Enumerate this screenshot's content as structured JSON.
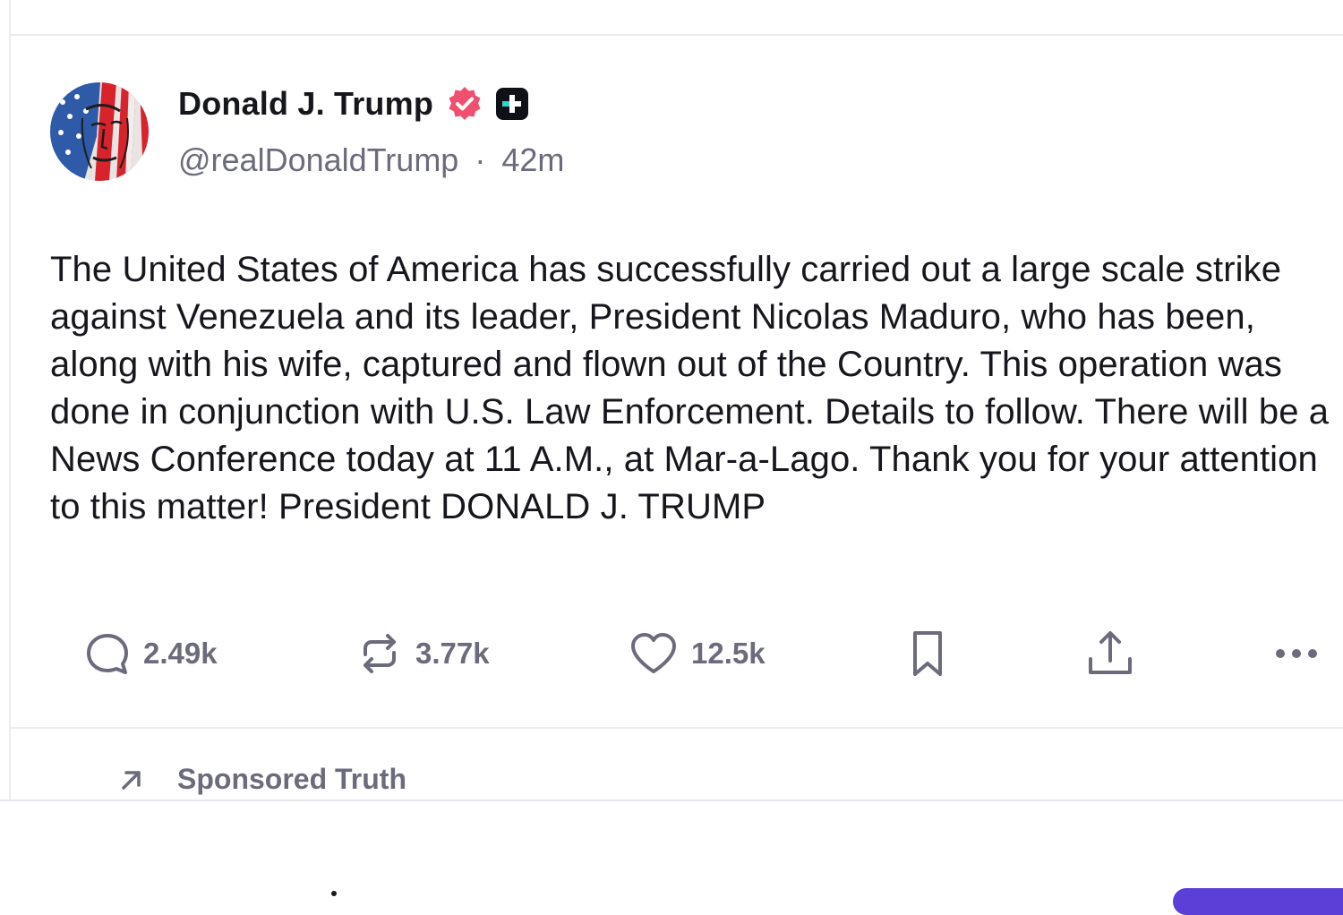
{
  "post": {
    "author": {
      "display_name": "Donald J. Trump",
      "handle": "@realDonaldTrump",
      "separator": "·",
      "time_ago": "42m",
      "verified_icon": "verified-badge-icon",
      "badge_icon": "plus-badge-icon"
    },
    "body": "The United States of America has successfully carried out a large scale strike against Venezuela and its leader, President Nicolas Maduro, who has been, along with his wife, captured and flown out of the Country. This operation was done in conjunction with U.S. Law Enforcement. Details to follow. There will be a News Conference today at 11 A.M., at Mar-a-Lago. Thank you for your attention to this matter! President DONALD J. TRUMP",
    "actions": {
      "replies": {
        "icon": "reply-icon",
        "count": "2.49k"
      },
      "retruths": {
        "icon": "repost-icon",
        "count": "3.77k"
      },
      "likes": {
        "icon": "heart-icon",
        "count": "12.5k"
      },
      "bookmark": {
        "icon": "bookmark-icon"
      },
      "share": {
        "icon": "share-icon"
      },
      "more": {
        "icon": "more-icon"
      }
    }
  },
  "sponsored": {
    "icon": "arrow-up-right-icon",
    "label": "Sponsored Truth"
  },
  "colors": {
    "text_primary": "#16161d",
    "text_secondary": "#6b6b7c",
    "verified_badge": "#f0506e",
    "divider": "#ececf0",
    "accent": "#5b3fd6"
  }
}
